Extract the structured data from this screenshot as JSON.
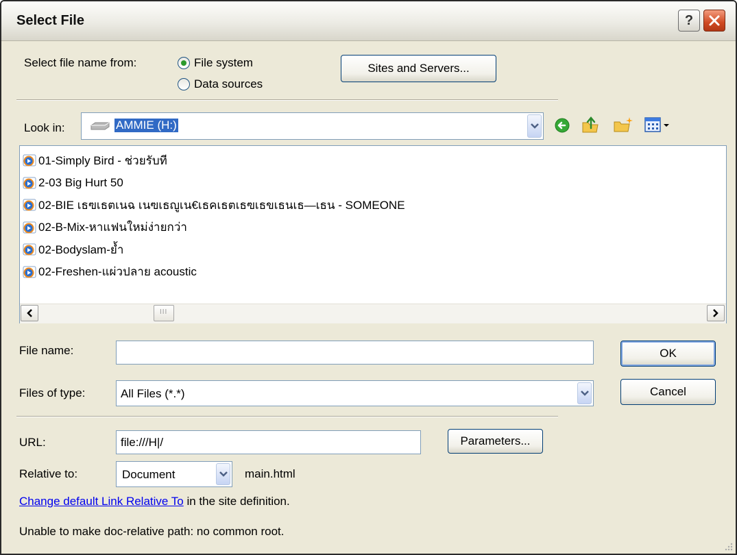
{
  "window": {
    "title": "Select File",
    "help_label": "?"
  },
  "source": {
    "label": "Select file name from:",
    "options": [
      {
        "label": "File system",
        "selected": true
      },
      {
        "label": "Data sources",
        "selected": false
      }
    ],
    "sites_button": "Sites and Servers..."
  },
  "look_in": {
    "label": "Look in:",
    "value": "AMMIE (H:)"
  },
  "files": [
    {
      "name": "01-Simply Bird - ช่วยรับที"
    },
    {
      "name": "2-03 Big Hurt 50"
    },
    {
      "name": "02-BIE เธฃเธตเนฉ เนฃเธญูเน€เธคเธตเธฃเธขเธนเธ—เธน - SOMEONE"
    },
    {
      "name": "02-B-Mix-หาแฟนใหม่ง่ายกว่า"
    },
    {
      "name": "02-Bodyslam-ย้ำ"
    },
    {
      "name": "02-Freshen-แผ่วปลาย acoustic"
    }
  ],
  "scrollbar": {
    "thumb_label": "III"
  },
  "file_name": {
    "label": "File name:",
    "value": ""
  },
  "file_type": {
    "label": "Files of type:",
    "value": "All Files (*.*)"
  },
  "ok_button": "OK",
  "cancel_button": "Cancel",
  "url": {
    "label": "URL:",
    "value": "file:///H|/"
  },
  "parameters_button": "Parameters...",
  "relative": {
    "label": "Relative to:",
    "value": "Document",
    "file": "main.html"
  },
  "change_link": {
    "link_text": "Change default Link Relative To",
    "suffix": " in the site definition."
  },
  "status_message": "Unable to make doc-relative path: no common root.",
  "colors": {
    "accent": "#2c9a2c",
    "link": "#0000ee",
    "close": "#d04a22"
  }
}
